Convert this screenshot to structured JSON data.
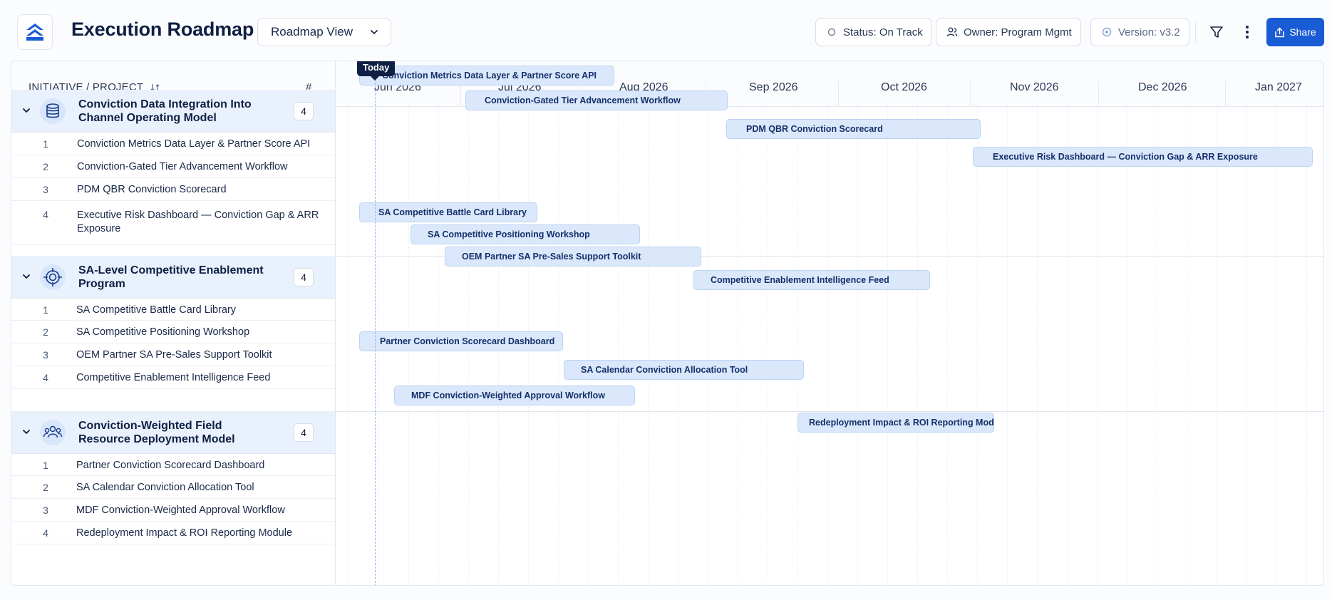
{
  "header": {
    "title": "Execution Roadmap",
    "view_select": "Roadmap View",
    "status": "Status: On Track",
    "owner": "Owner: Program Mgmt",
    "version": "Version: v3.2",
    "share_label": "Share"
  },
  "timeline": {
    "left_header": "INITIATIVE / PROJECT",
    "count_header": "#",
    "today_label": "Today",
    "months": [
      "Jun 2026",
      "Jul 2026",
      "Aug 2026",
      "Sep 2026",
      "Oct 2026",
      "Nov 2026",
      "Dec 2026",
      "Jan 2027"
    ]
  },
  "groups": [
    {
      "title": "Conviction Data Integration Into Channel Operating Model",
      "count": "4",
      "icon": "database-icon",
      "items": [
        {
          "num": "1",
          "label": "Conviction Metrics Data Layer & Partner Score API",
          "bar": "Conviction Metrics Data Layer & Partner Score API"
        },
        {
          "num": "2",
          "label": "Conviction-Gated Tier Advancement Workflow",
          "bar": "Conviction-Gated Tier Advancement Workflow"
        },
        {
          "num": "3",
          "label": "PDM QBR Conviction Scorecard",
          "bar": "PDM QBR Conviction Scorecard"
        },
        {
          "num": "4",
          "label": "Executive Risk Dashboard — Conviction Gap & ARR Exposure",
          "bar": "Executive Risk Dashboard — Conviction Gap & ARR Exposure"
        }
      ]
    },
    {
      "title": "SA-Level Competitive Enablement Program",
      "count": "4",
      "icon": "target-icon",
      "items": [
        {
          "num": "1",
          "label": "SA Competitive Battle Card Library",
          "bar": "SA Competitive Battle Card Library"
        },
        {
          "num": "2",
          "label": "SA Competitive Positioning Workshop",
          "bar": "SA Competitive Positioning Workshop"
        },
        {
          "num": "3",
          "label": "OEM Partner SA Pre-Sales Support Toolkit",
          "bar": "OEM Partner SA Pre-Sales Support Toolkit"
        },
        {
          "num": "4",
          "label": "Competitive Enablement Intelligence Feed",
          "bar": "Competitive Enablement Intelligence Feed"
        }
      ]
    },
    {
      "title": "Conviction-Weighted Field Resource Deployment Model",
      "count": "4",
      "icon": "people-icon",
      "items": [
        {
          "num": "1",
          "label": "Partner Conviction Scorecard Dashboard",
          "bar": "Partner Conviction Scorecard Dashboard"
        },
        {
          "num": "2",
          "label": "SA Calendar Conviction Allocation Tool",
          "bar": "SA Calendar Conviction Allocation Tool"
        },
        {
          "num": "3",
          "label": "MDF Conviction-Weighted Approval Workflow",
          "bar": "MDF Conviction-Weighted Approval Workflow"
        },
        {
          "num": "4",
          "label": "Redeployment Impact & ROI Reporting Module",
          "bar": "Redeployment Impact & ROI Reporting Modu"
        }
      ]
    }
  ],
  "colors": {
    "accent": "#1a5bd6",
    "group_bg": "#e9f1fd",
    "bar_fill": "#dbe8fb",
    "bar_border": "#bcd3f4",
    "text_primary": "#0f1f44"
  }
}
